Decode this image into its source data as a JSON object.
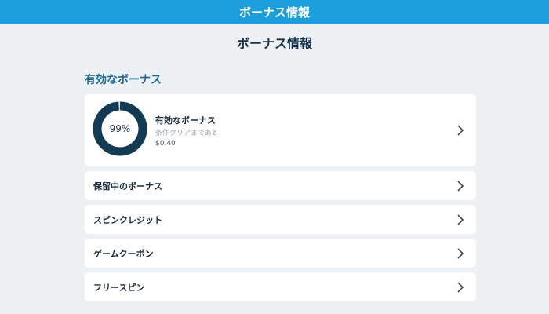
{
  "header": {
    "title": "ボーナス情報"
  },
  "page": {
    "title": "ボーナス情報"
  },
  "section": {
    "title": "有効なボーナス"
  },
  "active_bonus": {
    "percent_label": "99%",
    "percent": 0.99,
    "title": "有効なボーナス",
    "subtitle": "条件クリアまであと:",
    "amount": "$0.40"
  },
  "rows": [
    {
      "label": "保留中のボーナス"
    },
    {
      "label": "スピンクレジット"
    },
    {
      "label": "ゲームクーポン"
    },
    {
      "label": "フリースピン"
    }
  ],
  "colors": {
    "header_bg": "#1a9fdc",
    "donut_fill": "#123a52",
    "donut_track": "#d9e0e6",
    "section_title": "#1b6a92"
  }
}
